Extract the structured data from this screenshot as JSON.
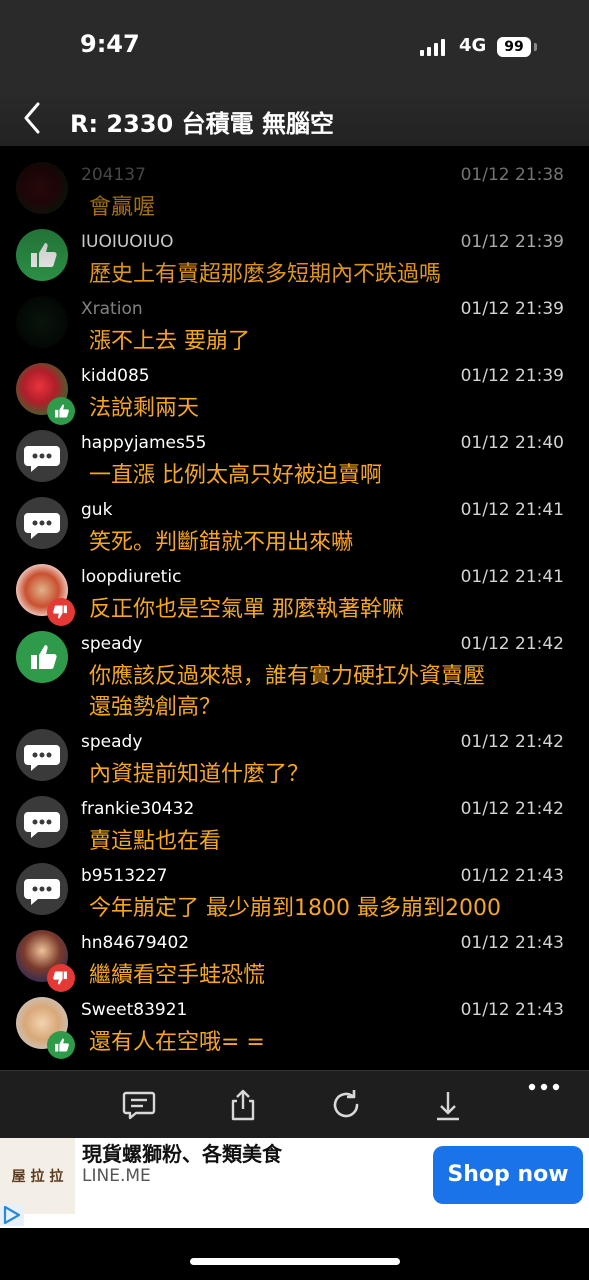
{
  "status_bar": {
    "time": "9:47",
    "network": "4G",
    "battery": "99"
  },
  "header": {
    "title": "R: 2330 台積電 無腦空"
  },
  "comments": [
    {
      "username": "204137",
      "time": "01/12 21:38",
      "content": "會贏喔",
      "avatar": "photo-dim",
      "badge": "none"
    },
    {
      "username": "IUOIUOIUO",
      "time": "01/12 21:39",
      "content": "歷史上有賣超那麼多短期內不跌過嗎",
      "avatar": "thumbs-up-icon",
      "badge": "none"
    },
    {
      "username": "Xration",
      "time": "01/12 21:39",
      "content": "漲不上去 要崩了",
      "avatar": "photo-dim",
      "badge": "none"
    },
    {
      "username": "kidd085",
      "time": "01/12 21:39",
      "content": "法說剩兩天",
      "avatar": "photo",
      "badge": "thumbs-up-badge-icon"
    },
    {
      "username": "happyjames55",
      "time": "01/12 21:40",
      "content": "一直漲 比例太高只好被迫賣啊",
      "avatar": "chat-bubble-icon",
      "badge": "none"
    },
    {
      "username": "guk",
      "time": "01/12 21:41",
      "content": "笑死。判斷錯就不用出來嚇",
      "avatar": "chat-bubble-icon",
      "badge": "none"
    },
    {
      "username": "loopdiuretic",
      "time": "01/12 21:41",
      "content": "反正你也是空氣單 那麼執著幹嘛",
      "avatar": "photo",
      "badge": "thumbs-down-badge-icon"
    },
    {
      "username": "speady",
      "time": "01/12 21:42",
      "content": "你應該反過來想，誰有實力硬扛外資賣壓",
      "content2": "還強勢創高？",
      "avatar": "thumbs-up-icon",
      "badge": "none"
    },
    {
      "username": "speady",
      "time": "01/12 21:42",
      "content": "內資提前知道什麼了？",
      "avatar": "chat-bubble-icon",
      "badge": "none"
    },
    {
      "username": "frankie30432",
      "time": "01/12 21:42",
      "content": "賣這點也在看",
      "avatar": "chat-bubble-icon",
      "badge": "none"
    },
    {
      "username": "b9513227",
      "time": "01/12 21:43",
      "content": "今年崩定了 最少崩到1800 最多崩到2000",
      "avatar": "chat-bubble-icon",
      "badge": "none"
    },
    {
      "username": "hn84679402",
      "time": "01/12 21:43",
      "content": "繼續看空手蛙恐慌",
      "avatar": "photo",
      "badge": "thumbs-down-badge-icon"
    },
    {
      "username": "Sweet83921",
      "time": "01/12 21:43",
      "content": "還有人在空哦= =",
      "avatar": "photo",
      "badge": "thumbs-up-badge-icon"
    }
  ],
  "toolbar": {
    "icons": [
      "comment-icon",
      "share-icon",
      "refresh-icon",
      "download-icon",
      "more-icon"
    ]
  },
  "ad": {
    "logo_text": "屋 拉 拉",
    "title": "現貨螺獅粉、各類美食",
    "domain": "LINE.ME",
    "cta": "Shop now"
  },
  "colors": {
    "background": "#000000",
    "comment_text": "#f5a623",
    "upvote": "#2e9a4a",
    "downvote": "#e53935",
    "cta": "#1a73e8"
  }
}
